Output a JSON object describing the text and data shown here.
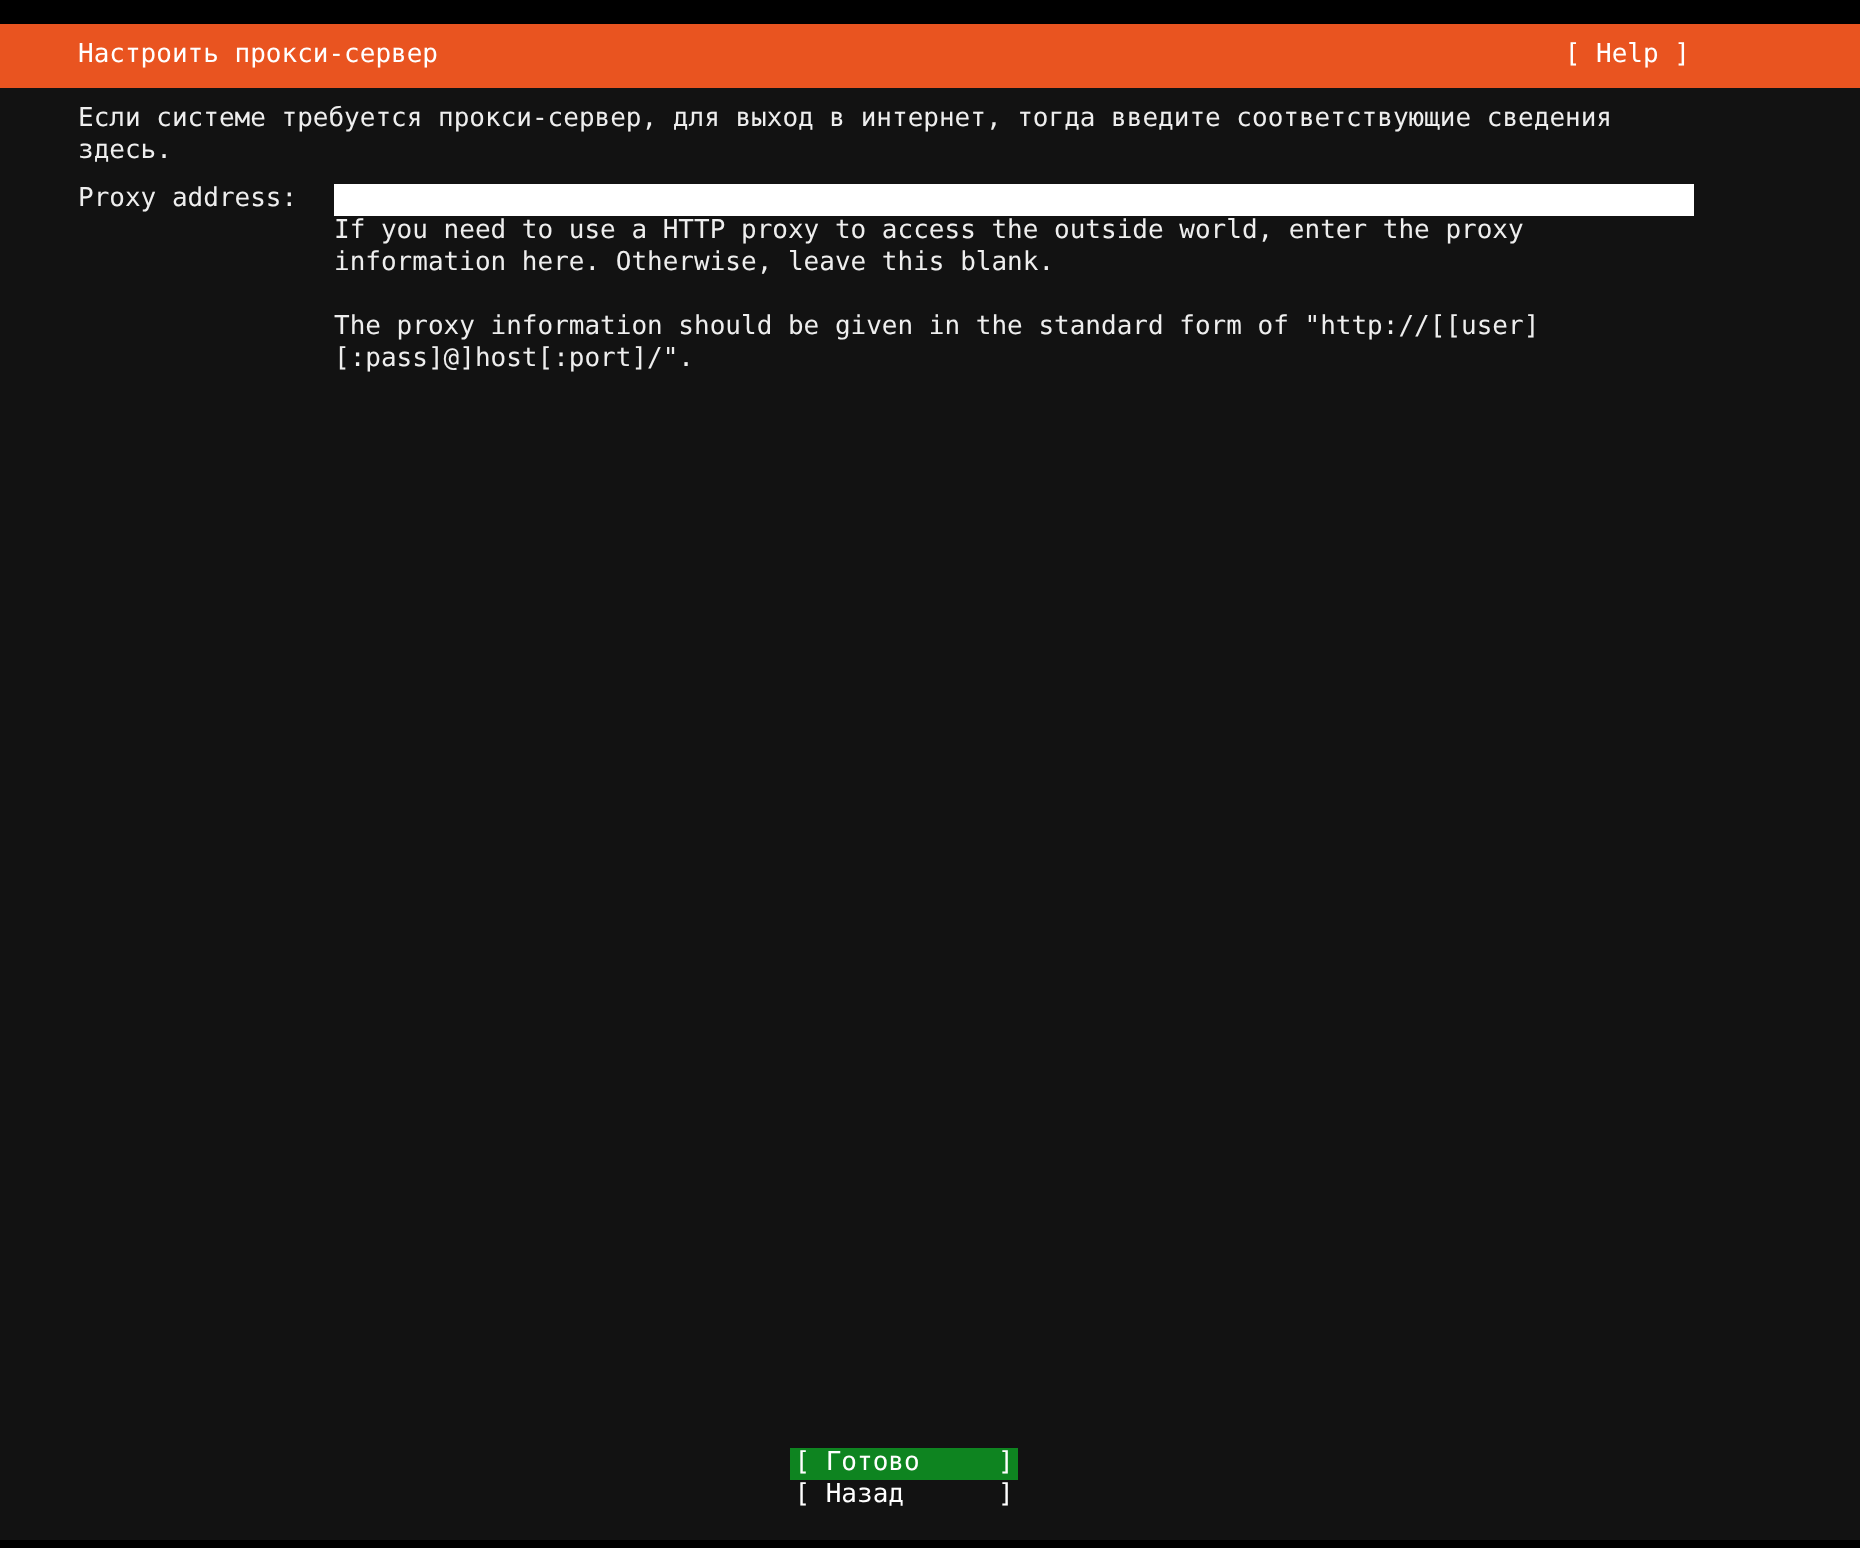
{
  "header": {
    "title": "Настроить прокси-сервер",
    "help": "[ Help ]"
  },
  "intro": "Если системе требуется прокси-сервер, для выход в интернет, тогда введите соответствующие сведения здесь.",
  "field": {
    "label": "Proxy address:",
    "help": [
      "If you need to use a HTTP proxy to access the outside world, enter the proxy information here. Otherwise, leave this blank.",
      "The proxy information should be given in the standard form of \"http://[[user][:pass]@]host[:port]/\"."
    ]
  },
  "buttons": [
    {
      "label": "[ Готово     ]",
      "selected": true
    },
    {
      "label": "[ Назад      ]",
      "selected": false
    }
  ]
}
